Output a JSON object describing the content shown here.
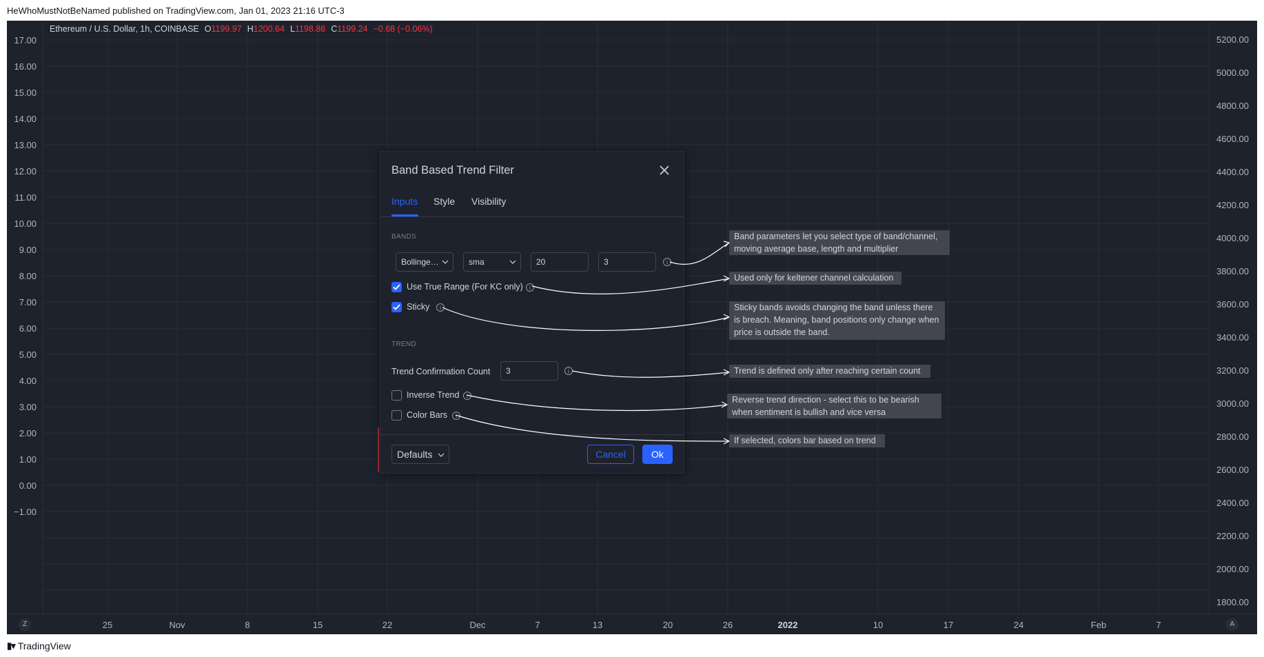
{
  "publish_header": "HeWhoMustNotBeNamed published on TradingView.com, Jan 01, 2023 21:16 UTC-3",
  "legend": {
    "symbol": "Ethereum / U.S. Dollar, 1h, COINBASE",
    "o_label": "O",
    "o_value": "1199.97",
    "h_label": "H",
    "h_value": "1200.64",
    "l_label": "L",
    "l_value": "1198.86",
    "c_label": "C",
    "c_value": "1199.24",
    "change": "−0.68 (−0.06%)"
  },
  "left_axis": [
    "17.00",
    "16.00",
    "15.00",
    "14.00",
    "13.00",
    "12.00",
    "11.00",
    "10.00",
    "9.00",
    "8.00",
    "7.00",
    "6.00",
    "5.00",
    "4.00",
    "3.00",
    "2.00",
    "1.00",
    "0.00",
    "−1.00"
  ],
  "right_axis": [
    "5200.00",
    "5000.00",
    "4800.00",
    "4600.00",
    "4400.00",
    "4200.00",
    "4000.00",
    "3800.00",
    "3600.00",
    "3400.00",
    "3200.00",
    "3000.00",
    "2800.00",
    "2600.00",
    "2400.00",
    "2200.00",
    "2000.00",
    "1800.00"
  ],
  "time_axis": [
    "25",
    "Nov",
    "8",
    "15",
    "22",
    "Dec",
    "7",
    "13",
    "20",
    "26",
    "2022",
    "10",
    "17",
    "24",
    "Feb",
    "7"
  ],
  "time_axis_bold": "2022",
  "scale_buttons": {
    "left": "Z",
    "right": "A"
  },
  "dialog": {
    "title": "Band Based Trend Filter",
    "tabs": [
      "Inputs",
      "Style",
      "Visibility"
    ],
    "active_tab": "Inputs",
    "bands_section": "BANDS",
    "band_type": "Bollinge…",
    "ma_type": "sma",
    "length": "20",
    "multiplier": "3",
    "use_true_range_label": "Use True Range (For KC only)",
    "use_true_range_checked": true,
    "sticky_label": "Sticky",
    "sticky_checked": true,
    "trend_section": "TREND",
    "trend_confirmation_label": "Trend Confirmation Count",
    "trend_confirmation_value": "3",
    "inverse_trend_label": "Inverse Trend",
    "inverse_trend_checked": false,
    "color_bars_label": "Color Bars",
    "color_bars_checked": false,
    "defaults_label": "Defaults",
    "cancel_label": "Cancel",
    "ok_label": "Ok"
  },
  "annotations": {
    "band_params": "Band parameters let you select type of band/channel, moving average base, length and multiplier",
    "true_range": "Used only for keltener channel calculation",
    "sticky": "Sticky bands avoids changing the band unless there is breach. Meaning, band positions only change when price is outside the band.",
    "trend_count": "Trend is defined only after reaching certain count",
    "inverse": "Reverse trend direction - select this to be bearish when sentiment is bullish and vice versa",
    "color_bars": "If selected, colors bar based on trend"
  },
  "footer_brand": "TradingView",
  "colors": {
    "accent": "#2962ff",
    "down": "#f23645",
    "background": "#1e222d",
    "note_bg": "#434651"
  }
}
